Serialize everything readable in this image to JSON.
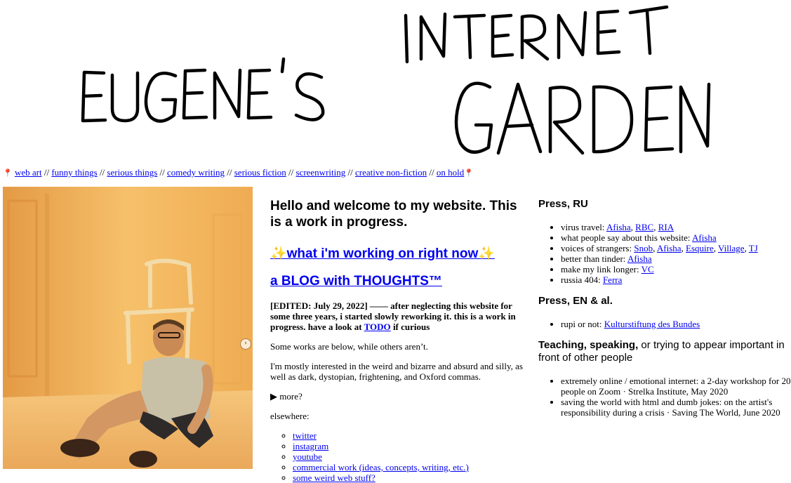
{
  "header": {
    "title": "EUGENE'S INTERNET GARDEN"
  },
  "nav": {
    "items": [
      {
        "label": "web art"
      },
      {
        "label": "funny things"
      },
      {
        "label": "serious things"
      },
      {
        "label": "comedy writing"
      },
      {
        "label": "serious fiction"
      },
      {
        "label": "screenwriting"
      },
      {
        "label": "creative non-fiction"
      },
      {
        "label": "on hold"
      }
    ],
    "separator": "//"
  },
  "photo": {
    "carousel_glyph": "›"
  },
  "main": {
    "welcome": "Hello and welcome to my website. This is a work in progress.",
    "working_on_link": "✨what i'm working on right now✨",
    "blog_link": "a BLOG with THOUGHTS™",
    "edited_prefix": "[EDITED: July 29, 2022] —— after neglecting this website for some three years, i started slowly reworking it. this is a work in progress. have a look at ",
    "todo_link": "TODO",
    "edited_suffix": " if curious",
    "works_note": "Some works are below, while others aren’t.",
    "interests": "I'm mostly interested in the weird and bizarre and absurd and silly, as well as dark, dystopian, frightening, and Oxford commas.",
    "more_label": "▶ more?",
    "elsewhere_label": "elsewhere:",
    "elsewhere": [
      {
        "label": "twitter"
      },
      {
        "label": "instagram"
      },
      {
        "label": "youtube"
      },
      {
        "label": "commercial work (ideas, concepts, writing, etc.)"
      },
      {
        "label": "some weird web stuff?"
      }
    ]
  },
  "press_ru": {
    "heading": "Press, RU",
    "items": [
      {
        "text": "virus travel: ",
        "links": [
          "Afisha",
          "RBC",
          "RIA"
        ]
      },
      {
        "text": "what people say about this website: ",
        "links": [
          "Afisha"
        ]
      },
      {
        "text": "voices of strangers: ",
        "links": [
          "Snob",
          "Afisha",
          "Esquire",
          "Village",
          "TJ"
        ]
      },
      {
        "text": "better than tinder: ",
        "links": [
          "Afisha"
        ]
      },
      {
        "text": "make my link longer: ",
        "links": [
          "VC"
        ]
      },
      {
        "text": "russia 404: ",
        "links": [
          "Ferra"
        ]
      }
    ]
  },
  "press_en": {
    "heading": "Press, EN & al.",
    "items": [
      {
        "text": "rupi or not: ",
        "links": [
          "Kulturstiftung des Bundes"
        ]
      }
    ]
  },
  "teaching": {
    "heading_bold": "Teaching, speaking,",
    "heading_rest": " or trying to appear important in front of other people",
    "items": [
      "extremely online / emotional internet: a 2-day workshop for 20 people on Zoom · Strelka Institute, May 2020",
      "saving the world with html and dumb jokes: on the artist's responsibility during a crisis · Saving The World, June 2020"
    ]
  }
}
